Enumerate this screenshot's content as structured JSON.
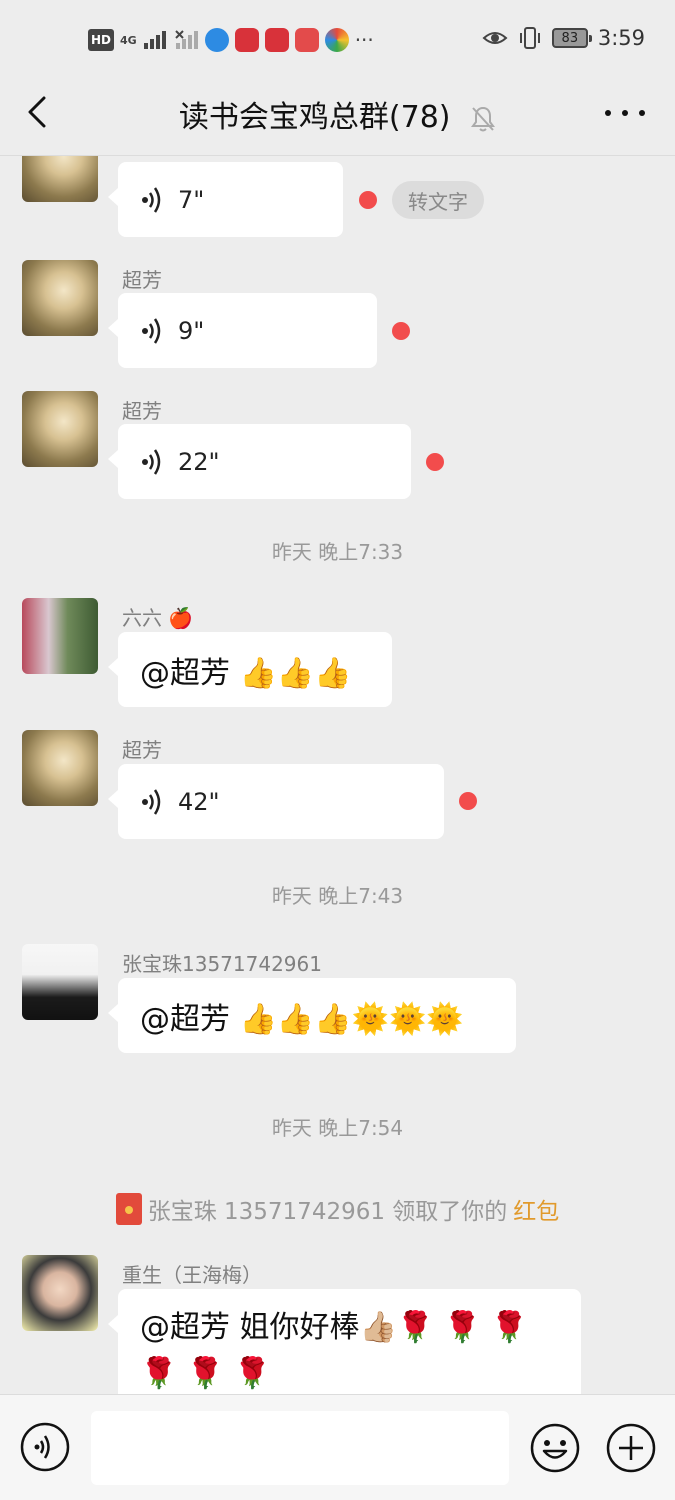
{
  "status_bar": {
    "left_badges": [
      "HD",
      "4G"
    ],
    "more": "···",
    "battery": "83",
    "time": "3:59"
  },
  "header": {
    "title": "读书会宝鸡总群(78)"
  },
  "messages": [
    {
      "type": "voice",
      "sender": "",
      "duration": "7\"",
      "unread": true,
      "to_text": "转文字"
    },
    {
      "type": "voice",
      "sender": "超芳",
      "duration": "9\"",
      "unread": true
    },
    {
      "type": "voice",
      "sender": "超芳",
      "duration": "22\"",
      "unread": true
    },
    {
      "type": "time",
      "text": "昨天 晚上7:33"
    },
    {
      "type": "text",
      "sender": "六六 🍎",
      "text": "@超芳 👍👍👍"
    },
    {
      "type": "voice",
      "sender": "超芳",
      "duration": "42\"",
      "unread": true
    },
    {
      "type": "time",
      "text": "昨天 晚上7:43"
    },
    {
      "type": "text",
      "sender": "张宝珠13571742961",
      "text": "@超芳 👍👍👍🌞🌞🌞"
    },
    {
      "type": "time",
      "text": "昨天 晚上7:54"
    },
    {
      "type": "system",
      "text": "张宝珠 13571742961 领取了你的",
      "link": "红包"
    },
    {
      "type": "text",
      "sender": "重生（王海梅）",
      "line1": "@超芳  姐你好棒👍🏼🌹 🌹 🌹",
      "line2": "🌹 🌹 🌹"
    }
  ],
  "colors": {
    "background": "#ededed",
    "bubble": "#ffffff",
    "unread_dot": "#f24c4c",
    "redpack_link": "#e19a2c"
  }
}
